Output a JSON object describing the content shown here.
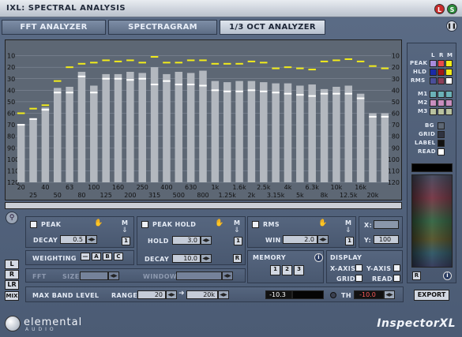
{
  "window": {
    "title": "IXL: SPECTRAL ANALYSIS",
    "l_btn": "L",
    "s_btn": "S"
  },
  "tabs": [
    {
      "label": "FFT ANALYZER"
    },
    {
      "label": "SPECTRAGRAM"
    },
    {
      "label": "1/3 OCT ANALYZER"
    }
  ],
  "active_tab": "1/3 OCT ANALYZER",
  "pause_icon": "pause-icon",
  "chart_data": {
    "type": "bar",
    "y_ticks_left": [
      "10",
      "20",
      "30",
      "40",
      "50",
      "60",
      "70",
      "80",
      "90",
      "100",
      "110",
      "120"
    ],
    "y_ticks_right": [
      "10",
      "20",
      "30",
      "40",
      "50",
      "60",
      "70",
      "80",
      "90",
      "100",
      "110",
      "120"
    ],
    "x_top_labels": [
      "20",
      "40",
      "63",
      "100",
      "160",
      "250",
      "400",
      "630",
      "1k",
      "1.6k",
      "2.5k",
      "4k",
      "6.3k",
      "10k",
      "16k"
    ],
    "x_bottom_labels": [
      "25",
      "50",
      "80",
      "125",
      "200",
      "315",
      "500",
      "800",
      "1.25k",
      "2k",
      "3.15k",
      "5k",
      "8k",
      "12.5k",
      "20k"
    ],
    "categories": [
      "20",
      "25",
      "31",
      "40",
      "50",
      "63",
      "80",
      "100",
      "125",
      "160",
      "200",
      "250",
      "315",
      "400",
      "500",
      "630",
      "800",
      "1k",
      "1.25k",
      "1.6k",
      "2k",
      "2.5k",
      "3.15k",
      "4k",
      "5k",
      "6.3k",
      "8k",
      "10k",
      "12.5k",
      "16k",
      "20k"
    ],
    "ylabel_unit": "dB",
    "ylim": [
      -120,
      0
    ],
    "rms_values": [
      -70,
      -65,
      -55,
      -38,
      -37,
      -24,
      -36,
      -26,
      -26,
      -24,
      -25,
      -20,
      -26,
      -24,
      -25,
      -23,
      -32,
      -33,
      -32,
      -32,
      -33,
      -34,
      -34,
      -36,
      -35,
      -39,
      -37,
      -36,
      -43,
      -60,
      -60
    ],
    "rms_line": [
      -70,
      -65,
      -57,
      -42,
      -42,
      -28,
      -42,
      -30,
      -30,
      -31,
      -30,
      -35,
      -32,
      -35,
      -35,
      -36,
      -40,
      -41,
      -41,
      -40,
      -41,
      -42,
      -43,
      -44,
      -45,
      -43,
      -43,
      -43,
      -47,
      -63,
      -63
    ],
    "peak_hold": [
      -60,
      -56,
      -53,
      -32,
      -20,
      -17,
      -16,
      -14,
      -15,
      -14,
      -16,
      -11,
      -16,
      -16,
      -14,
      -14,
      -17,
      -17,
      -17,
      -15,
      -16,
      -21,
      -20,
      -21,
      -22,
      -15,
      -14,
      -13,
      -15,
      -19,
      -21
    ],
    "colors": {
      "bar": "#b3b8bf",
      "peak": "#f2ec1a",
      "rms": "#ffffff",
      "grid": "#8a93a0",
      "bg": "#5d6774"
    }
  },
  "peak": {
    "label": "PEAK",
    "decay_label": "DECAY",
    "decay_value": "0.5",
    "m_label": "M",
    "m_value": "1"
  },
  "peak_hold": {
    "label": "PEAK HOLD",
    "hold_label": "HOLD",
    "hold_value": "3.0",
    "decay_label": "DECAY",
    "decay_value": "10.0",
    "m_label": "M",
    "m_value": "1",
    "r_label": "R"
  },
  "rms": {
    "label": "RMS",
    "win_label": "WIN",
    "win_value": "2.0",
    "m_label": "M",
    "m_value": "1"
  },
  "coords": {
    "x_label": "X:",
    "x_value": "",
    "y_label": "Y:",
    "y_value": "100"
  },
  "weighting": {
    "label": "WEIGHTING",
    "options": [
      "—",
      "A",
      "B",
      "C"
    ]
  },
  "memory": {
    "label": "MEMORY",
    "slots": [
      "1",
      "2",
      "3"
    ]
  },
  "display": {
    "label": "DISPLAY",
    "x_axis": "X-AXIS",
    "y_axis": "Y-AXIS",
    "grid": "GRID",
    "read": "READ"
  },
  "fft": {
    "label": "FFT",
    "size_label": "SIZE",
    "window_label": "WINDOW"
  },
  "band": {
    "label": "MAX BAND LEVEL",
    "range_label": "RANGE",
    "range_from": "20",
    "range_to": "20k",
    "level_value": "-10.3",
    "th_label": "TH",
    "th_value": "-10.0"
  },
  "channels": [
    "L",
    "R",
    "LR",
    "MIX"
  ],
  "legend": {
    "l": "L",
    "r": "R",
    "m": "M",
    "rows": [
      "PEAK",
      "HLD",
      "RMS"
    ],
    "mem_rows": [
      "M1",
      "M2",
      "M3"
    ],
    "bg": "BG",
    "grid": "GRID",
    "label": "LABEL",
    "read": "READ",
    "r_btn": "R",
    "info_icon": "i"
  },
  "export_label": "EXPORT",
  "brand": {
    "name": "elemental",
    "sub": "AUDIO",
    "product": "InspectorXL"
  }
}
